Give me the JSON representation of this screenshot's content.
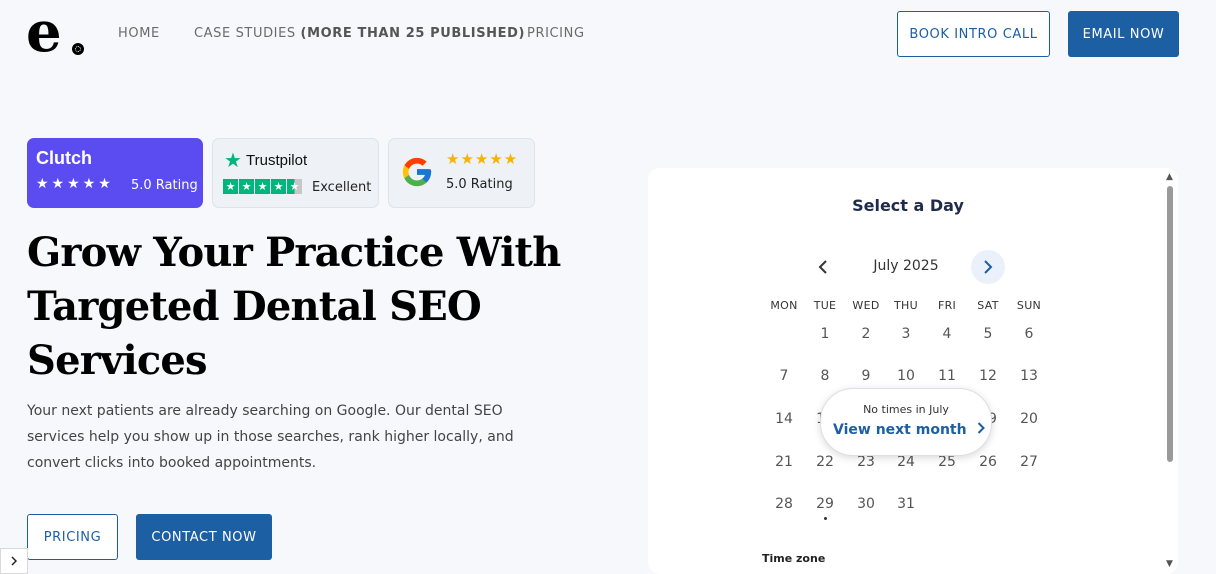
{
  "nav": {
    "links": [
      "HOME",
      "CASE STUDIES",
      "PRICING"
    ],
    "case_studies_note": "(MORE THAN 25 PUBLISHED)",
    "book_call": "BOOK INTRO CALL",
    "email_now": "EMAIL NOW"
  },
  "badges": {
    "clutch": {
      "name": "Clutch",
      "stars": "★★★★★",
      "rating": "5.0 Rating",
      "rating_value": 5.0
    },
    "trustpilot": {
      "name": "Trustpilot",
      "label": "Excellent",
      "rating_value": 4.5
    },
    "google": {
      "stars": "★★★★★",
      "rating": "5.0 Rating",
      "rating_value": 5.0
    }
  },
  "hero": {
    "title_lines": [
      "Grow Your Practice With",
      "Targeted Dental SEO",
      "Services"
    ],
    "text_lines": [
      "Your next patients are already searching on Google. Our dental SEO",
      "services help you show up in those searches, rank higher locally, and",
      "convert clicks into booked appointments."
    ],
    "pricing_button": "PRICING",
    "contact_button": "CONTACT NOW"
  },
  "calendar": {
    "title": "Select a Day",
    "month": "July 2025",
    "weekdays": [
      "MON",
      "TUE",
      "WED",
      "THU",
      "FRI",
      "SAT",
      "SUN"
    ],
    "first_day_offset": 1,
    "days_in_month": 31,
    "today": 29,
    "popup_message": "No times in July",
    "popup_link": "View next month",
    "timezone_label": "Time zone"
  },
  "colors": {
    "brand_blue": "#1d5fa3",
    "clutch_purple": "#5a4cf0",
    "trustpilot_green": "#00b67a",
    "google_star": "#f5b400"
  },
  "icons": [
    "chevron-left-icon",
    "chevron-right-icon",
    "trustpilot-star-icon",
    "google-g-icon",
    "scroll-up-icon",
    "scroll-down-icon"
  ]
}
